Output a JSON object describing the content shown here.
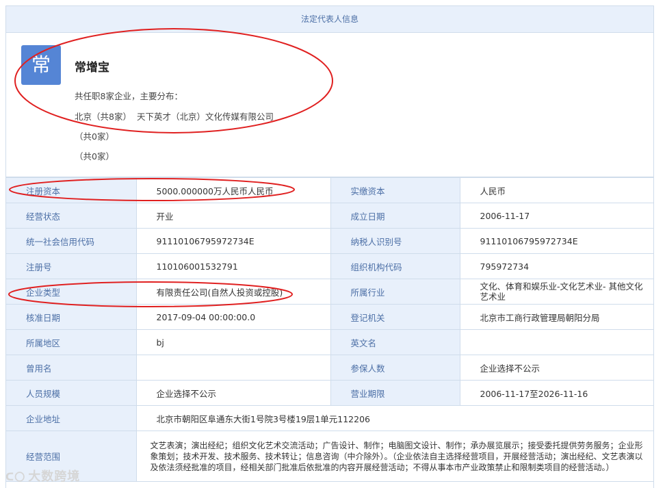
{
  "header": {
    "title": "法定代表人信息"
  },
  "person": {
    "avatar_char": "常",
    "name": "常增宝",
    "summary": "共任职8家企业，主要分布：",
    "region_line": "北京（共8家）",
    "company": "天下英才（北京）文化传媒有限公司",
    "extra1": "（共0家）",
    "extra2": "（共0家）"
  },
  "table": {
    "rows": [
      {
        "l1": "注册资本",
        "v1": "5000.000000万人民币人民币",
        "l2": "实缴资本",
        "v2": "人民币"
      },
      {
        "l1": "经营状态",
        "v1": "开业",
        "l2": "成立日期",
        "v2": "2006-11-17"
      },
      {
        "l1": "统一社会信用代码",
        "v1": "91110106795972734E",
        "l2": "纳税人识别号",
        "v2": "91110106795972734E"
      },
      {
        "l1": "注册号",
        "v1": "110106001532791",
        "l2": "组织机构代码",
        "v2": "795972734"
      },
      {
        "l1": "企业类型",
        "v1": "有限责任公司(自然人投资或控股)",
        "l2": "所属行业",
        "v2": "文化、体育和娱乐业-文化艺术业- 其他文化艺术业"
      },
      {
        "l1": "核准日期",
        "v1": "2017-09-04 00:00:00.0",
        "l2": "登记机关",
        "v2": "北京市工商行政管理局朝阳分局"
      },
      {
        "l1": "所属地区",
        "v1": "bj",
        "l2": "英文名",
        "v2": ""
      },
      {
        "l1": "曾用名",
        "v1": "",
        "l2": "参保人数",
        "v2": "企业选择不公示"
      },
      {
        "l1": "人员规模",
        "v1": "企业选择不公示",
        "l2": "营业期限",
        "v2": "2006-11-17至2026-11-16"
      }
    ],
    "address": {
      "label": "企业地址",
      "value": "北京市朝阳区阜通东大街1号院3号楼19层1单元112206"
    },
    "scope": {
      "label": "经营范围",
      "value": "文艺表演；演出经纪；组织文化艺术交流活动；广告设计、制作；电脑图文设计、制作；承办展览展示；接受委托提供劳务服务；企业形象策划；技术开发、技术服务、技术转让；信息咨询（中介除外）。（企业依法自主选择经营项目，开展经营活动；演出经纪、文艺表演以及依法须经批准的项目，经相关部门批准后依批准的内容开展经营活动；不得从事本市产业政策禁止和限制类项目的经营活动。）"
    }
  },
  "annotation_color": "#e02020",
  "watermark": {
    "text": "大数跨境"
  }
}
